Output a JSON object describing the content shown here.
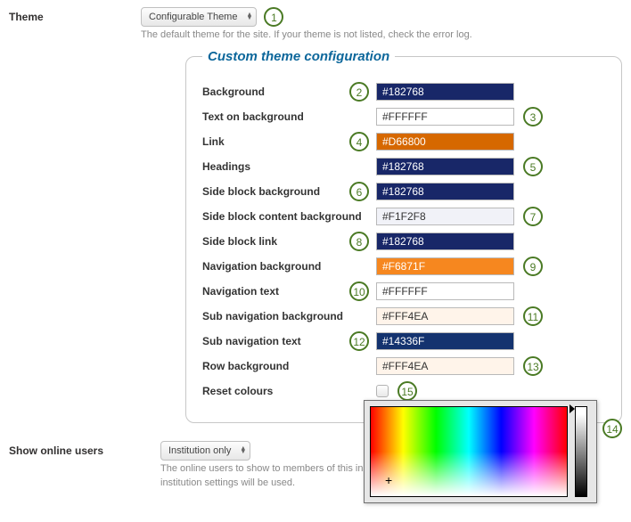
{
  "theme": {
    "label": "Theme",
    "select_value": "Configurable Theme",
    "help": "The default theme for the site. If your theme is not listed, check the error log."
  },
  "fieldset": {
    "legend": "Custom theme configuration",
    "fields": [
      {
        "label": "Background",
        "value": "#182768",
        "bg": "#182768",
        "fg": "#ffffff",
        "marker_side": "left",
        "marker": "2"
      },
      {
        "label": "Text on background",
        "value": "#FFFFFF",
        "bg": "#ffffff",
        "fg": "#333333",
        "marker_side": "right",
        "marker": "3"
      },
      {
        "label": "Link",
        "value": "#D66800",
        "bg": "#D66800",
        "fg": "#ffffff",
        "marker_side": "left",
        "marker": "4"
      },
      {
        "label": "Headings",
        "value": "#182768",
        "bg": "#182768",
        "fg": "#ffffff",
        "marker_side": "right",
        "marker": "5"
      },
      {
        "label": "Side block background",
        "value": "#182768",
        "bg": "#182768",
        "fg": "#ffffff",
        "marker_side": "left",
        "marker": "6"
      },
      {
        "label": "Side block content background",
        "value": "#F1F2F8",
        "bg": "#F1F2F8",
        "fg": "#333333",
        "marker_side": "right",
        "marker": "7"
      },
      {
        "label": "Side block link",
        "value": "#182768",
        "bg": "#182768",
        "fg": "#ffffff",
        "marker_side": "left",
        "marker": "8"
      },
      {
        "label": "Navigation background",
        "value": "#F6871F",
        "bg": "#F6871F",
        "fg": "#ffffff",
        "marker_side": "right",
        "marker": "9"
      },
      {
        "label": "Navigation text",
        "value": "#FFFFFF",
        "bg": "#ffffff",
        "fg": "#333333",
        "marker_side": "left",
        "marker": "10"
      },
      {
        "label": "Sub navigation background",
        "value": "#FFF4EA",
        "bg": "#FFF4EA",
        "fg": "#333333",
        "marker_side": "right",
        "marker": "11"
      },
      {
        "label": "Sub navigation text",
        "value": "#14336F",
        "bg": "#14336F",
        "fg": "#ffffff",
        "marker_side": "left",
        "marker": "12"
      },
      {
        "label": "Row background",
        "value": "#FFF4EA",
        "bg": "#FFF4EA",
        "fg": "#333333",
        "marker_side": "right",
        "marker": "13"
      }
    ],
    "reset": {
      "label": "Reset colours",
      "marker": "15"
    }
  },
  "marker1": "1",
  "marker14": "14",
  "online": {
    "label": "Show online users",
    "select_value": "Institution only",
    "help": "The online users to show to members of this institution. If this is set to none, the most permissive institution settings will be used."
  }
}
